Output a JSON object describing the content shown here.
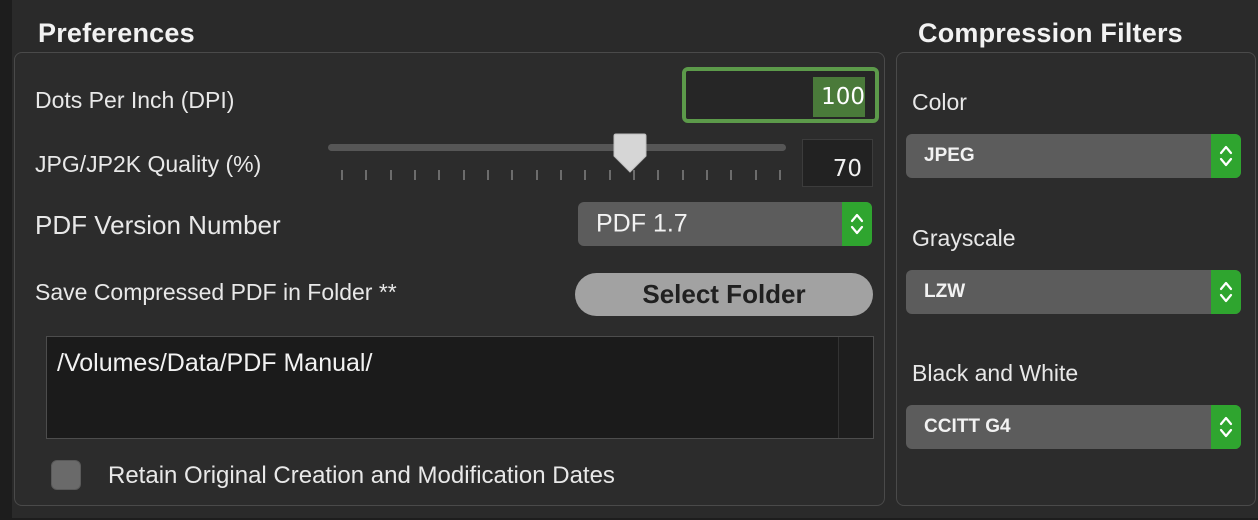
{
  "preferences": {
    "title": "Preferences",
    "dpi": {
      "label": "Dots Per Inch (DPI)",
      "value": "100"
    },
    "quality": {
      "label": "JPG/JP2K Quality (%)",
      "value": "70",
      "slider_fraction": 0.62
    },
    "pdf_version": {
      "label": "PDF Version Number",
      "selected": "PDF 1.7"
    },
    "save_folder": {
      "label": "Save Compressed PDF in Folder **",
      "button_label": "Select Folder"
    },
    "folder_path": "/Volumes/Data/PDF Manual/",
    "retain_dates": {
      "label": "Retain Original Creation and Modification Dates",
      "checked": false
    }
  },
  "compression": {
    "title": "Compression Filters",
    "color": {
      "label": "Color",
      "selected": "JPEG"
    },
    "grayscale": {
      "label": "Grayscale",
      "selected": "LZW"
    },
    "black_white": {
      "label": "Black and White",
      "selected": "CCITT G4"
    }
  },
  "colors": {
    "background": "#2a2a2a",
    "accent_green": "#2fa52f",
    "focus_ring": "#5c9a4a",
    "popup_bg": "#5c5c5c"
  },
  "icons": {
    "popup_arrows": "chevron-up-down-icon",
    "slider_thumb": "slider-thumb-icon"
  }
}
